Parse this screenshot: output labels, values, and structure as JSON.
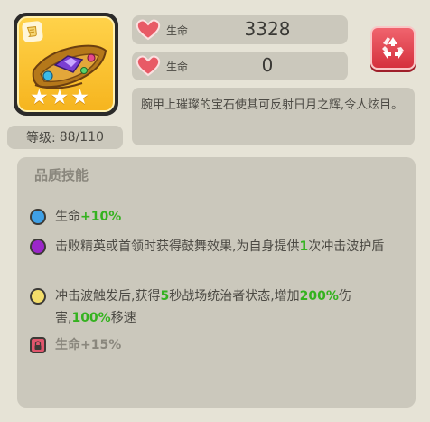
{
  "item": {
    "icon": "gem-bracer-icon",
    "badge_icon": "scroll-icon",
    "frame_color": "#f6b51f",
    "stars": 3,
    "level_label": "等级:",
    "level_value": "88/110"
  },
  "stats": [
    {
      "icon": "heart-icon",
      "label": "生命",
      "value": "3328"
    },
    {
      "icon": "heart-icon",
      "label": "生命",
      "value": "0"
    }
  ],
  "recycle_button": {
    "icon": "recycle-icon",
    "color": "#d5303d"
  },
  "description": "腕甲上璀璨的宝石使其可反射日月之辉,令人炫目。",
  "skills": {
    "title": "品质技能",
    "items": [
      {
        "dot_color": "#3fa0e6",
        "parts": [
          "生命",
          "+10%"
        ]
      },
      {
        "dot_color": "#9b27c9",
        "parts": [
          "击败精英或首领时获得鼓舞效果,为自身提供",
          "1",
          "次冲击波护盾"
        ]
      },
      {
        "dot_color": "#f3dd6a",
        "parts": [
          "冲击波触发后,获得",
          "5",
          "秒战场统治者状态,增加",
          "200%",
          "伤害,",
          "100%",
          "移速"
        ]
      }
    ],
    "locked": {
      "icon": "lock-icon",
      "text": "生命+15%"
    }
  }
}
